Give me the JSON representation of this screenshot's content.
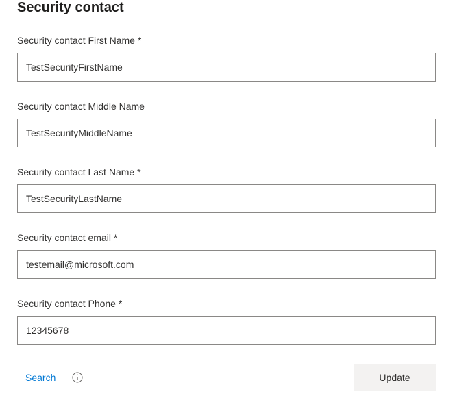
{
  "section": {
    "title": "Security contact"
  },
  "fields": {
    "firstName": {
      "label": "Security contact First Name",
      "value": "TestSecurityFirstName",
      "required": true
    },
    "middleName": {
      "label": "Security contact Middle Name",
      "value": "TestSecurityMiddleName",
      "required": false
    },
    "lastName": {
      "label": "Security contact Last Name",
      "value": "TestSecurityLastName",
      "required": true
    },
    "email": {
      "label": "Security contact email",
      "value": "testemail@microsoft.com",
      "required": true
    },
    "phone": {
      "label": "Security contact Phone",
      "value": "12345678",
      "required": true
    }
  },
  "footer": {
    "searchLabel": "Search",
    "updateLabel": "Update"
  }
}
